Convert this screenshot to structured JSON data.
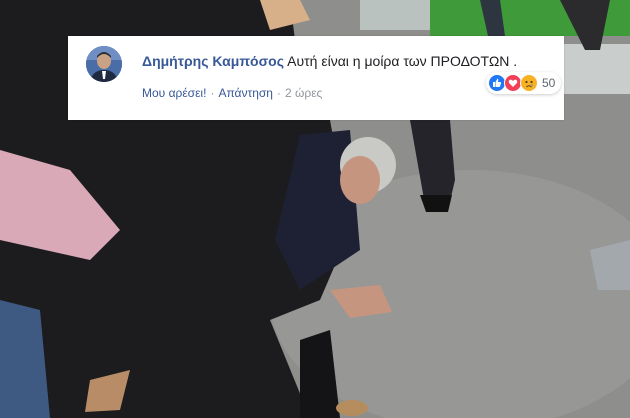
{
  "comment": {
    "author": "Δημήτρης Καμπόσος",
    "text": "Αυτή είναι η μοίρα των ΠΡΟΔΟΤΩΝ .",
    "actions": {
      "like_label": "Μου αρέσει!",
      "separator": "·",
      "reply_label": "Απάντηση",
      "time": "2 ώρες"
    },
    "reactions": {
      "icons": [
        "like-icon",
        "love-icon",
        "sad-icon"
      ],
      "count": "50"
    }
  },
  "colors": {
    "author_link": "#385898",
    "like": "#2078f4",
    "love": "#f33e58",
    "sad": "#f7b125"
  }
}
